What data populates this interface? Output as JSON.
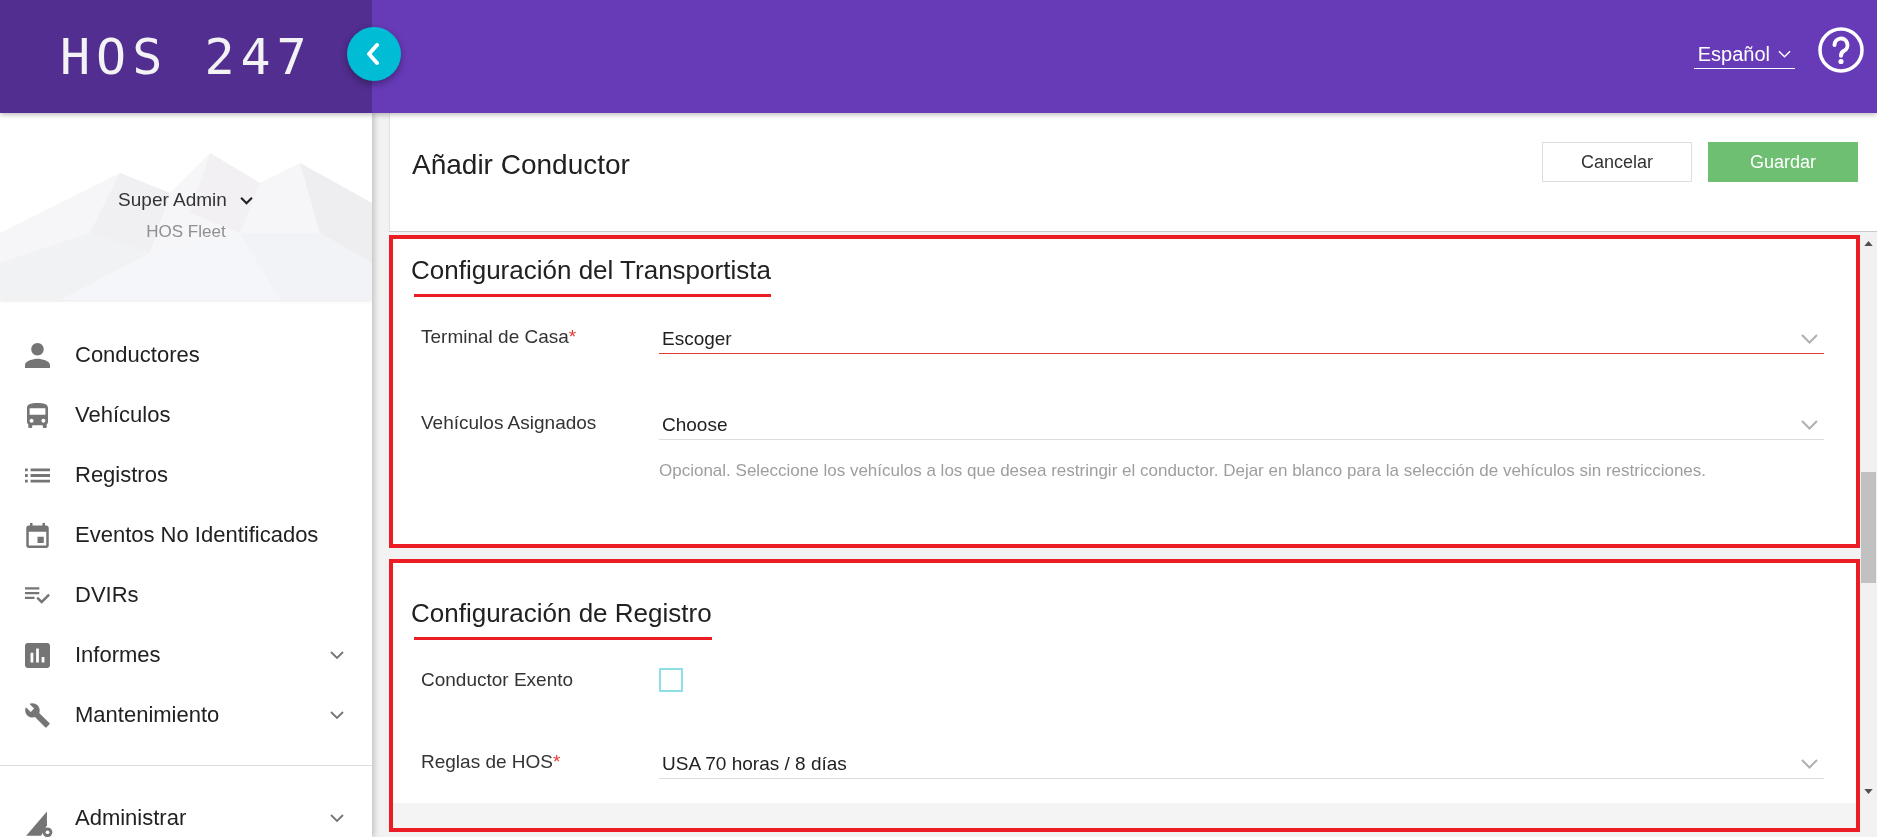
{
  "header": {
    "logo": "HOS 247",
    "language": "Español"
  },
  "sidebar": {
    "user": {
      "name": "Super Admin",
      "organization": "HOS Fleet"
    },
    "items": [
      {
        "label": "Conductores",
        "selected": false,
        "has_submenu": false
      },
      {
        "label": "Vehículos",
        "selected": false,
        "has_submenu": false
      },
      {
        "label": "Registros",
        "selected": false,
        "has_submenu": false
      },
      {
        "label": "Eventos No Identificados",
        "selected": false,
        "has_submenu": false
      },
      {
        "label": "DVIRs",
        "selected": false,
        "has_submenu": false
      },
      {
        "label": "Informes",
        "selected": false,
        "has_submenu": true
      },
      {
        "label": "Mantenimiento",
        "selected": false,
        "has_submenu": true
      }
    ],
    "footer_items": [
      {
        "label": "Administrar",
        "selected": false,
        "has_submenu": true
      }
    ]
  },
  "page": {
    "title": "Añadir Conductor",
    "buttons": [
      {
        "label": "Cancelar",
        "kind": "outline",
        "disabled": false
      },
      {
        "label": "Guardar",
        "kind": "primary",
        "disabled": true
      }
    ]
  },
  "sections": [
    {
      "title": "Configuración del Transportista",
      "annotated": true,
      "fields": [
        {
          "kind": "select",
          "label": "Terminal de Casa",
          "required_mark": "*",
          "value": "Escoger",
          "invalid": true
        },
        {
          "kind": "select",
          "label": "Vehículos Asignados",
          "value": "Choose",
          "invalid": false,
          "hint": "Opcional. Seleccione los vehículos a los que desea restringir el conductor. Dejar en blanco para la selección de vehículos sin restricciones."
        }
      ]
    },
    {
      "title": "Configuración de Registro",
      "annotated": true,
      "fields": [
        {
          "kind": "checkbox",
          "label": "Conductor Exento",
          "checked": false
        },
        {
          "kind": "select",
          "label": "Reglas de HOS",
          "required_mark": "*",
          "value": "USA 70 horas / 8 días",
          "invalid": false
        }
      ]
    }
  ]
}
